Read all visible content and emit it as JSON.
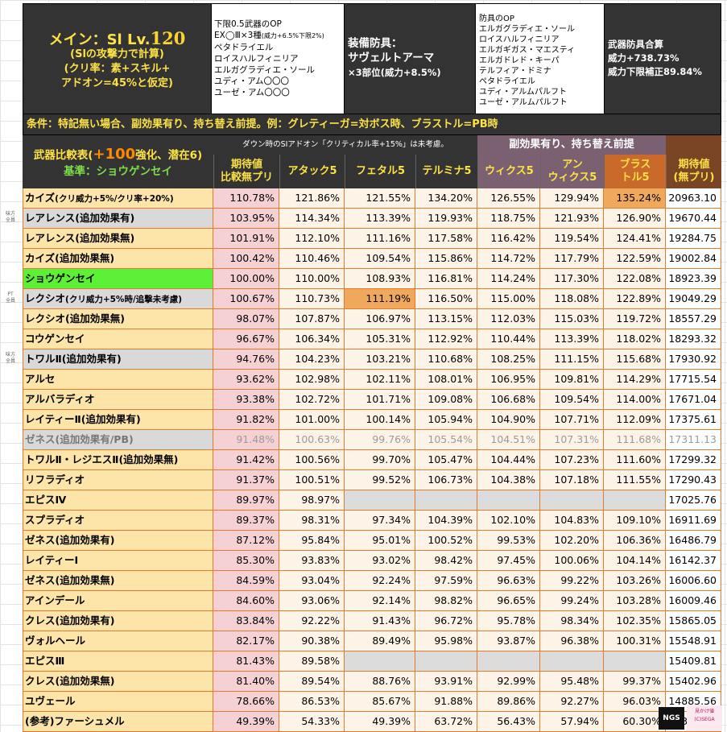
{
  "header": {
    "main": {
      "line1_prefix": "メイン：Sl Lv.",
      "line1_level": "120",
      "line2": "(Slの攻撃力で計算)",
      "line3": "(クリ率：素+スキル+",
      "line4": "アドオン=45%と仮定)"
    },
    "weapon_op": {
      "line1": "下限0.5武器のOP",
      "line2_main": "EX◯Ⅲ×3種",
      "line2_small": "(威力+6.5%下限2%)",
      "line3": "ペタドライエル",
      "line4": "ロイスハルフィニリア",
      "line5": "エルガグラディエ・ソール",
      "line6": "ユディ・アム〇〇〇",
      "line7": "ユーゼ・アム〇〇〇"
    },
    "armor": {
      "line1": "装備防具：",
      "line2": "サヴェルトアーマ",
      "line3": "×3部位(威力+8.5%)"
    },
    "armor_op": {
      "line1": "防具のOP",
      "line2": "エルガグラディエ・ソール",
      "line3": "ロイスハルフィニリア",
      "line4": "エルガギガス・マエスティ",
      "line5": "エルガドレド・キーパ",
      "line6": "テルフィア・ドミナ",
      "line7": "ペタドライエル",
      "line8": "ユディ・アルムパルフト",
      "line9": "ユーゼ・アルムパルフト"
    },
    "total": {
      "line1": "武器防具合算",
      "line2": "威力+738.73%",
      "line3": "威力下限補正89.84%"
    }
  },
  "condition": "条件：特記無い場合、副効果有り、持ち替え前提。例：グレティーガ=対ボス時、ブラストル=PB時",
  "table_header": {
    "title_prefix": "武器比較表(",
    "title_big": "+100",
    "title_suffix": "強化、潜在6)",
    "baseline": "基準：ショウゲンセイ",
    "down_note": "ダウン時のSIアドオン「クリティカル率+15%」は未考慮。",
    "sub_note": "副効果有り、持ち替え前提",
    "columns": [
      {
        "line1": "期待値",
        "line2": "比較無プリ"
      },
      {
        "line1": "アタック5",
        "line2": ""
      },
      {
        "line1": "フェタル5",
        "line2": ""
      },
      {
        "line1": "テルミナ5",
        "line2": ""
      },
      {
        "line1": "ウィクス5",
        "line2": ""
      },
      {
        "line1": "アン",
        "line2": "ウィクス5"
      },
      {
        "line1": "ブラス",
        "line2": "トル5"
      },
      {
        "line1": "期待値",
        "line2": "(無プリ)"
      }
    ]
  },
  "side_notes": [
    {
      "line1": "味方",
      "line2": "全員"
    },
    {
      "line1": "PT",
      "line2": "全員"
    },
    {
      "line1": "味方",
      "line2": "全員"
    }
  ],
  "rows": [
    {
      "name": "カイズ",
      "name_small": "(クリ威力+5%/クリ率+20%)",
      "style": "",
      "values": [
        "110.78%",
        "121.86%",
        "121.55%",
        "134.20%",
        "126.55%",
        "129.94%",
        "135.24%",
        "20963.10"
      ]
    },
    {
      "name": "レアレンス(追加効果有)",
      "name_small": "",
      "style": "gray",
      "values": [
        "103.95%",
        "114.34%",
        "113.39%",
        "119.93%",
        "118.75%",
        "121.93%",
        "126.90%",
        "19670.44"
      ]
    },
    {
      "name": "レアレンス(追加効果無)",
      "name_small": "",
      "style": "",
      "values": [
        "101.91%",
        "112.10%",
        "111.16%",
        "117.58%",
        "116.42%",
        "119.54%",
        "124.41%",
        "19284.75"
      ]
    },
    {
      "name": "カイズ(追加効果無)",
      "name_small": "",
      "style": "",
      "values": [
        "100.42%",
        "110.46%",
        "109.54%",
        "115.86%",
        "114.72%",
        "117.79%",
        "122.59%",
        "19002.84"
      ]
    },
    {
      "name": "ショウゲンセイ",
      "name_small": "",
      "style": "green",
      "values": [
        "100.00%",
        "110.00%",
        "108.93%",
        "116.81%",
        "114.24%",
        "117.30%",
        "122.08%",
        "18923.39"
      ]
    },
    {
      "name": "レクシオ",
      "name_small": "(クリ威力+5%時/追撃未考慮)",
      "style": "gray",
      "values": [
        "100.67%",
        "110.73%",
        "111.19%",
        "116.50%",
        "115.00%",
        "118.08%",
        "122.89%",
        "19049.29"
      ]
    },
    {
      "name": "レクシオ(追加効果無)",
      "name_small": "",
      "style": "",
      "values": [
        "98.07%",
        "107.87%",
        "106.97%",
        "113.15%",
        "112.03%",
        "115.03%",
        "119.72%",
        "18557.29"
      ]
    },
    {
      "name": "コウゲンセイ",
      "name_small": "",
      "style": "",
      "values": [
        "96.67%",
        "106.34%",
        "105.31%",
        "112.92%",
        "110.44%",
        "113.39%",
        "118.02%",
        "18293.32"
      ]
    },
    {
      "name": "トワルⅡ(追加効果有)",
      "name_small": "",
      "style": "gray",
      "values": [
        "94.76%",
        "104.23%",
        "103.21%",
        "110.68%",
        "108.25%",
        "111.15%",
        "115.68%",
        "17930.92"
      ]
    },
    {
      "name": "アルセ",
      "name_small": "",
      "style": "",
      "values": [
        "93.62%",
        "102.98%",
        "102.11%",
        "108.01%",
        "106.95%",
        "109.81%",
        "114.29%",
        "17715.54"
      ]
    },
    {
      "name": "アルバラディオ",
      "name_small": "",
      "style": "",
      "values": [
        "93.38%",
        "102.72%",
        "101.71%",
        "109.08%",
        "106.68%",
        "109.54%",
        "114.00%",
        "17671.04"
      ]
    },
    {
      "name": "レイティーⅡ(追加効果有)",
      "name_small": "",
      "style": "",
      "values": [
        "91.82%",
        "101.00%",
        "100.14%",
        "105.94%",
        "104.90%",
        "107.71%",
        "112.09%",
        "17375.61"
      ]
    },
    {
      "name": "ゼネス(追加効果有/PB)",
      "name_small": "",
      "style": "gray",
      "values": [
        "91.48%",
        "100.63%",
        "99.76%",
        "105.54%",
        "104.51%",
        "107.31%",
        "111.68%",
        "17311.13"
      ]
    },
    {
      "name": "トワルⅡ・レジエスⅡ(追加効果無)",
      "name_small": "",
      "style": "",
      "values": [
        "91.42%",
        "100.56%",
        "99.70%",
        "105.47%",
        "104.44%",
        "107.23%",
        "111.60%",
        "17299.32"
      ]
    },
    {
      "name": "リフラディオ",
      "name_small": "",
      "style": "",
      "values": [
        "91.37%",
        "100.51%",
        "99.52%",
        "106.73%",
        "104.38%",
        "107.18%",
        "111.55%",
        "17290.43"
      ]
    },
    {
      "name": "エピスⅣ",
      "name_small": "",
      "style": "",
      "values": [
        "89.97%",
        "98.97%",
        "",
        "",
        "",
        "",
        "",
        "17025.76"
      ]
    },
    {
      "name": "スプラディオ",
      "name_small": "",
      "style": "",
      "values": [
        "89.37%",
        "98.31%",
        "97.34%",
        "104.39%",
        "102.10%",
        "104.83%",
        "109.10%",
        "16911.69"
      ]
    },
    {
      "name": "ゼネス(追加効果有)",
      "name_small": "",
      "style": "",
      "values": [
        "87.12%",
        "95.84%",
        "95.01%",
        "100.52%",
        "99.53%",
        "102.20%",
        "106.36%",
        "16486.79"
      ]
    },
    {
      "name": "レイティーⅠ",
      "name_small": "",
      "style": "",
      "values": [
        "85.30%",
        "93.83%",
        "93.02%",
        "98.42%",
        "97.45%",
        "100.06%",
        "104.14%",
        "16142.37"
      ]
    },
    {
      "name": "ゼネス(追加効果無)",
      "name_small": "",
      "style": "",
      "values": [
        "84.59%",
        "93.04%",
        "92.24%",
        "97.59%",
        "96.63%",
        "99.22%",
        "103.26%",
        "16006.60"
      ]
    },
    {
      "name": "アインデール",
      "name_small": "",
      "style": "",
      "values": [
        "84.60%",
        "93.06%",
        "92.14%",
        "98.82%",
        "96.65%",
        "99.24%",
        "103.28%",
        "16009.46"
      ]
    },
    {
      "name": "クレス(追加効果有)",
      "name_small": "",
      "style": "",
      "values": [
        "83.84%",
        "92.22%",
        "91.43%",
        "96.72%",
        "95.78%",
        "98.34%",
        "102.35%",
        "15865.05"
      ]
    },
    {
      "name": "ヴォルヘール",
      "name_small": "",
      "style": "",
      "values": [
        "82.17%",
        "90.38%",
        "89.49%",
        "95.98%",
        "93.87%",
        "96.38%",
        "100.31%",
        "15548.91"
      ]
    },
    {
      "name": "エピスⅢ",
      "name_small": "",
      "style": "",
      "values": [
        "81.43%",
        "89.58%",
        "",
        "",
        "",
        "",
        "",
        "15409.81"
      ]
    },
    {
      "name": "クレス(追加効果無)",
      "name_small": "",
      "style": "",
      "values": [
        "81.40%",
        "89.54%",
        "88.76%",
        "93.91%",
        "92.99%",
        "95.48%",
        "99.37%",
        "15402.96"
      ]
    },
    {
      "name": "ユヴェール",
      "name_small": "",
      "style": "",
      "values": [
        "78.66%",
        "86.53%",
        "85.67%",
        "91.88%",
        "89.86%",
        "92.27%",
        "96.03%",
        "14885.56"
      ]
    },
    {
      "name": "(参考)ファーシュメル",
      "name_small": "",
      "style": "",
      "values": [
        "49.39%",
        "54.33%",
        "49.39%",
        "63.72%",
        "56.43%",
        "57.94%",
        "60.30%",
        "9346.64"
      ]
    }
  ],
  "logos": {
    "ngs": "NGS",
    "ngs_sub": "LOGO",
    "stamp_line1": "見かけ値",
    "stamp_line2": "(C)SEGA"
  },
  "colors": {
    "header_bg": "#333333",
    "header_yellow": "#fde246",
    "name_cell": "#fde4a8",
    "baseline_green": "#5cf036",
    "highlight_orange": "#f0a85c",
    "expected_pink": "#f5d1d4",
    "border_orange": "#e57a2a"
  }
}
